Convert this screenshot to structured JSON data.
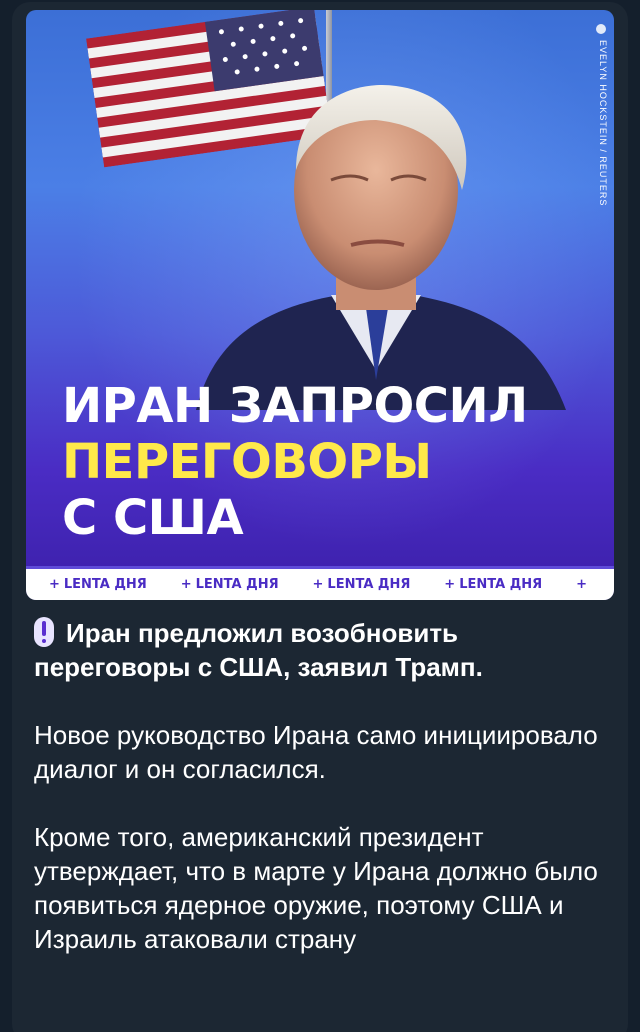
{
  "image": {
    "photo_credit": "EVELYN HOCKSTEIN / REUTERS",
    "headline_line1": "ИРАН ЗАПРОСИЛ",
    "headline_line2": "ПЕРЕГОВОРЫ",
    "headline_line3": "С США",
    "ticker_items": [
      "LENTA ДНЯ",
      "LENTA ДНЯ",
      "LENTA ДНЯ",
      "LENTA ДНЯ"
    ],
    "ticker_separator": "+",
    "accent_color": "#ffe94a",
    "gradient_colors": [
      "#3c6fd6",
      "#4a2cc4"
    ]
  },
  "message": {
    "lead_icon": "exclamation-icon",
    "lead_text": "Иран предложил возобновить переговоры с США, заявил Трамп.",
    "paragraph_1": "Новое руководство Ирана само инициировало диалог и он согласился.",
    "paragraph_2": "Кроме того, американский президент утверждает, что в марте у Ирана должно было появиться ядерное оружие, поэтому США и Израиль атаковали страну"
  }
}
